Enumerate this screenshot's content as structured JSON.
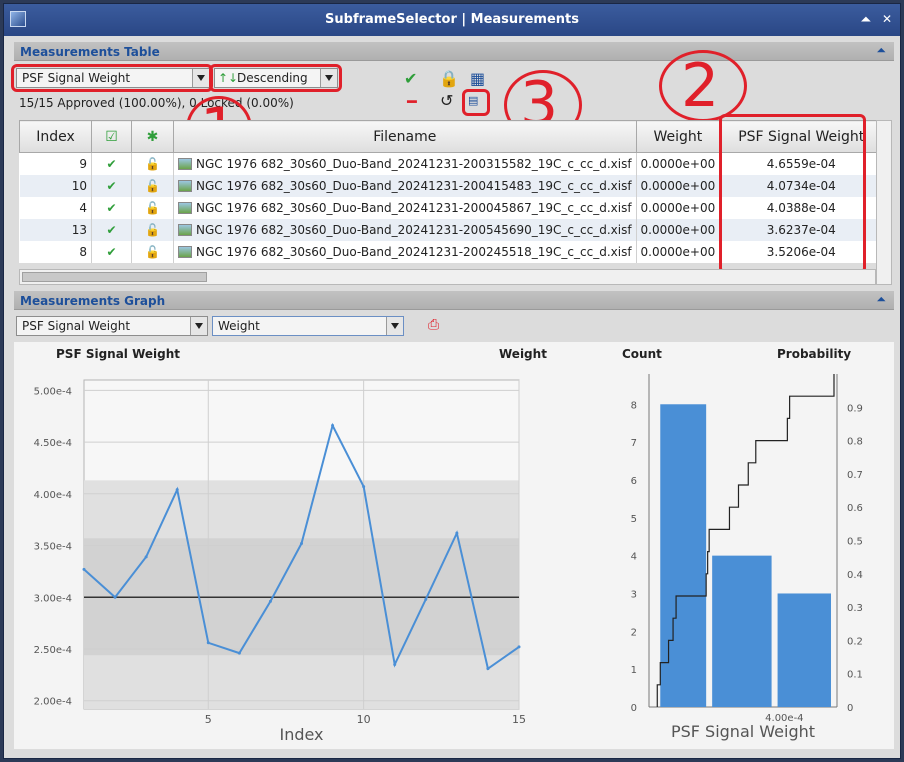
{
  "window": {
    "title": "SubframeSelector | Measurements"
  },
  "table_section": {
    "label": "Measurements Table",
    "sort_property": "PSF Signal Weight",
    "sort_order": "Descending",
    "status": "15/15 Approved (100.00%), 0 Locked (0.00%)",
    "columns": [
      "Index",
      "",
      "",
      "",
      "Filename",
      "Weight",
      "PSF Signal Weight"
    ],
    "rows": [
      {
        "index": "9",
        "filename": "NGC 1976 682_30s60_Duo-Band_20241231-200315582_19C_c_cc_d.xisf",
        "weight": "0.0000e+00",
        "psf": "4.6559e-04"
      },
      {
        "index": "10",
        "filename": "NGC 1976 682_30s60_Duo-Band_20241231-200415483_19C_c_cc_d.xisf",
        "weight": "0.0000e+00",
        "psf": "4.0734e-04"
      },
      {
        "index": "4",
        "filename": "NGC 1976 682_30s60_Duo-Band_20241231-200045867_19C_c_cc_d.xisf",
        "weight": "0.0000e+00",
        "psf": "4.0388e-04"
      },
      {
        "index": "13",
        "filename": "NGC 1976 682_30s60_Duo-Band_20241231-200545690_19C_c_cc_d.xisf",
        "weight": "0.0000e+00",
        "psf": "3.6237e-04"
      },
      {
        "index": "8",
        "filename": "NGC 1976 682_30s60_Duo-Band_20241231-200245518_19C_c_cc_d.xisf",
        "weight": "0.0000e+00",
        "psf": "3.5206e-04"
      }
    ],
    "annotations": [
      "1",
      "2",
      "3"
    ]
  },
  "graph_section": {
    "label": "Measurements Graph",
    "y_property": "PSF Signal Weight",
    "x_property": "Weight",
    "left_title": "PSF Signal Weight",
    "right_title_weight": "Weight",
    "hist_count_label": "Count",
    "hist_prob_label": "Probability"
  },
  "chart_data": [
    {
      "type": "line",
      "title": "PSF Signal Weight",
      "xlabel": "Index",
      "ylabel": "",
      "x": [
        1,
        2,
        3,
        4,
        5,
        6,
        7,
        8,
        9,
        10,
        11,
        12,
        13,
        14,
        15
      ],
      "y": [
        0.000327,
        0.0003,
        0.000339,
        0.000404,
        0.000256,
        0.000246,
        0.000296,
        0.000352,
        0.000466,
        0.000407,
        0.000235,
        0.000298,
        0.000362,
        0.000231,
        0.000252
      ],
      "xlim": [
        1,
        15
      ],
      "ylim": [
        0.000192,
        0.00051
      ],
      "x_ticks": [
        "5",
        "10",
        "15"
      ],
      "y_ticks": [
        "2.00e-4",
        "2.50e-4",
        "3.00e-4",
        "3.50e-4",
        "4.00e-4",
        "4.50e-4",
        "5.00e-4"
      ],
      "mean": 0.0003,
      "band_inner": [
        0.000244,
        0.000357
      ],
      "band_outer": [
        0.000192,
        0.000413
      ],
      "grid": true,
      "line_color": "#4a8fd6"
    },
    {
      "type": "bar",
      "title": "",
      "xlabel": "PSF Signal Weight",
      "ylabel": "Count",
      "y2label": "Probability",
      "bins": [
        [
          0.000231,
          0.0003
        ],
        [
          0.0003,
          0.000387
        ],
        [
          0.000387,
          0.000466
        ]
      ],
      "values": [
        8,
        4,
        3
      ],
      "ylim": [
        0,
        8.8
      ],
      "y_ticks": [
        "0",
        "1",
        "2",
        "3",
        "4",
        "5",
        "6",
        "7",
        "8"
      ],
      "y2_ticks": [
        "0",
        "0.1",
        "0.2",
        "0.3",
        "0.4",
        "0.5",
        "0.6",
        "0.7",
        "0.8",
        "0.9"
      ],
      "x_ticks": [
        "4.00e-4"
      ],
      "bar_color": "#4a8fd6",
      "cdf_steps": [
        0,
        0.0667,
        0.1333,
        0.2,
        0.2667,
        0.3333,
        0.4,
        0.4667,
        0.5333,
        0.6,
        0.6667,
        0.7333,
        0.8,
        0.8667,
        0.9333,
        1.0
      ]
    }
  ]
}
